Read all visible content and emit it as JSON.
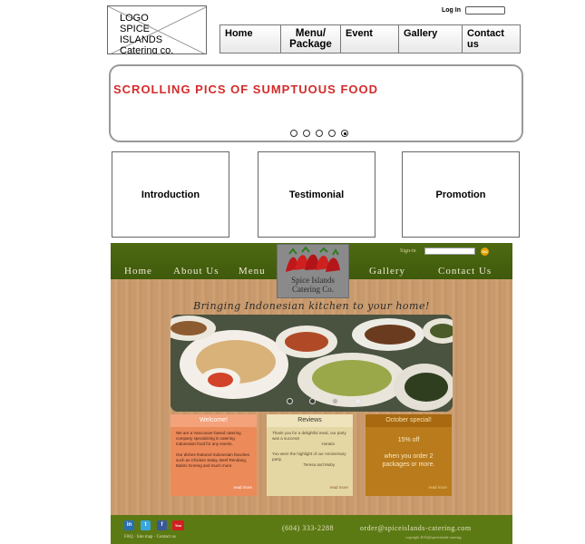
{
  "wireframe": {
    "logo_lines": [
      "LOGO",
      "SPICE",
      "ISLANDS",
      "Catering co."
    ],
    "login_label": "Log In",
    "nav": [
      "Home",
      "Menu/ Package",
      "Event",
      "Gallery",
      "Contact us"
    ],
    "banner_text": "SCROLLING PICS OF SUMPTUOUS FOOD",
    "slide_dots": 5,
    "active_slide": 5,
    "boxes": [
      "Introduction",
      "Testimonial",
      "Promotion"
    ]
  },
  "mockup": {
    "nav": [
      "Home",
      "About Us",
      "Menu",
      "Gallery",
      "Contact Us"
    ],
    "signin_label": "Sign-in",
    "go_label": "GO",
    "logo_text": [
      "Spice Islands",
      "Catering Co."
    ],
    "tagline": "Bringing Indonesian kitchen to your home!",
    "photo_dots": 4,
    "active_photo": 4,
    "welcome": {
      "title": "Welcome!",
      "paragraphs": [
        "We are a Vancouver-based catering company specializing in catering Indonesian food for any events.",
        "Our dishes featured Indonesian favorites such as Chicken Satay, Beef Rendang, Bakmi Goreng and much more."
      ],
      "read_more": "read more"
    },
    "reviews": {
      "title": "Reviews",
      "items": [
        {
          "text": "Thank you for a delightful meal, our party was a success!",
          "by": "Horatio"
        },
        {
          "text": "You were the highlight of our Anniversary party.",
          "by": "Teresa and Moby"
        }
      ],
      "read_more": "read more"
    },
    "special": {
      "title": "October special!",
      "discount": "15% off",
      "condition": "when you order 2 packages or more.",
      "read_more": "read more"
    },
    "footer": {
      "social": [
        "in",
        "t",
        "f",
        "You"
      ],
      "links": "FAQ · Site map · Contact us",
      "phone": "(604) 333-2288",
      "email": "order@spiceislands-catering.com",
      "copyright": "copyright 2012@spiceislands-catering"
    }
  }
}
